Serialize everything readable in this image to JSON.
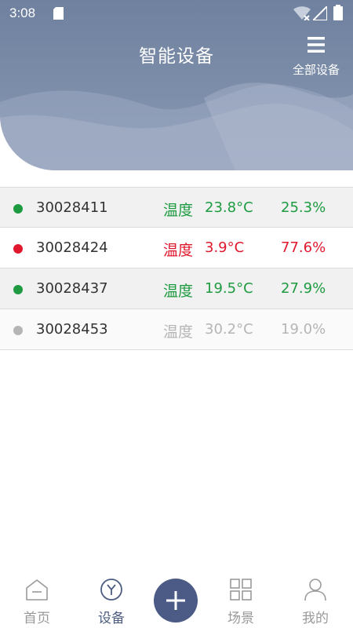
{
  "status_bar": {
    "time": "3:08"
  },
  "header": {
    "title": "智能设备",
    "menu_label": "全部设备",
    "menu_icon": "hamburger-menu-icon"
  },
  "colors": {
    "online": "#1e9b41",
    "alarm": "#e0182d",
    "offline": "#b5b5b5",
    "nav_active": "#4d5d80",
    "nav_inactive": "#999999"
  },
  "devices": [
    {
      "id": "30028411",
      "temp_label": "温度",
      "temp": "23.8°C",
      "humidity": "25.3%",
      "status": "online"
    },
    {
      "id": "30028424",
      "temp_label": "温度",
      "temp": "3.9°C",
      "humidity": "77.6%",
      "status": "alarm"
    },
    {
      "id": "30028437",
      "temp_label": "温度",
      "temp": "19.5°C",
      "humidity": "27.9%",
      "status": "online"
    },
    {
      "id": "30028453",
      "temp_label": "温度",
      "temp": "30.2°C",
      "humidity": "19.0%",
      "status": "offline"
    }
  ],
  "nav": {
    "home": {
      "label": "首页",
      "icon": "home-icon"
    },
    "devices": {
      "label": "设备",
      "icon": "device-icon",
      "active": true
    },
    "add": {
      "icon": "plus-icon"
    },
    "scenes": {
      "label": "场景",
      "icon": "grid-icon"
    },
    "mine": {
      "label": "我的",
      "icon": "user-icon"
    }
  }
}
